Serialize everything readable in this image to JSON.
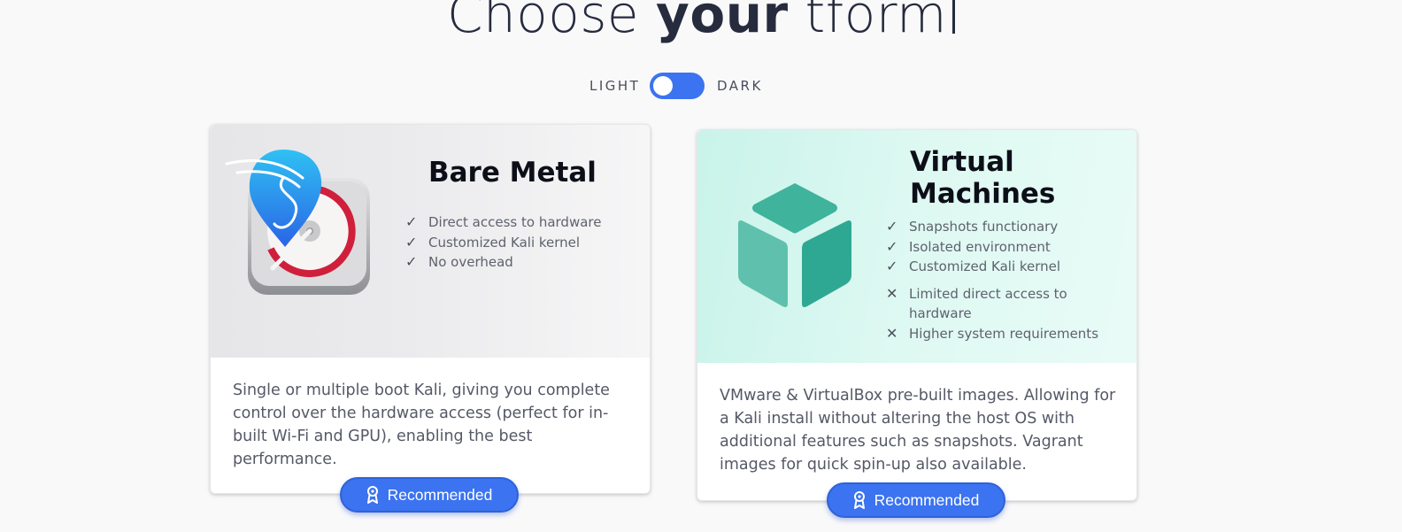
{
  "heading": {
    "prefix": "Choose ",
    "emphasis": "your",
    "suffix": " tform"
  },
  "theme_toggle": {
    "light_label": "LIGHT",
    "dark_label": "DARK",
    "state": "light"
  },
  "cards": [
    {
      "title": "Bare Metal",
      "features": [
        {
          "icon": "check-icon",
          "text": "Direct access to hardware"
        },
        {
          "icon": "check-icon",
          "text": "Customized Kali kernel"
        },
        {
          "icon": "check-icon",
          "text": "No overhead"
        }
      ],
      "description": "Single or multiple boot Kali, giving you complete control over the hardware access (perfect for in-built Wi-Fi and GPU), enabling the best performance.",
      "button_label": "Recommended",
      "image_icon": "kali-dragon-harddrive-icon"
    },
    {
      "title": "Virtual Machines",
      "features": [
        {
          "icon": "check-icon",
          "text": "Snapshots functionary"
        },
        {
          "icon": "check-icon",
          "text": "Isolated environment"
        },
        {
          "icon": "check-icon",
          "text": "Customized Kali kernel"
        },
        {
          "icon": "cross-icon",
          "text": "Limited direct access to hardware"
        },
        {
          "icon": "cross-icon",
          "text": "Higher system requirements"
        }
      ],
      "description": "VMware & VirtualBox pre-built images. Allowing for a Kali install without altering the host OS with additional features such as snapshots. Vagrant images for quick spin-up also available.",
      "button_label": "Recommended",
      "image_icon": "cube-icon"
    }
  ],
  "colors": {
    "accent": "#3b73f0",
    "page_background": "#f9f9fa",
    "vm_panel": "#d8f7f0",
    "bm_panel": "#e8e8ea",
    "cube": "#3fb39c"
  }
}
